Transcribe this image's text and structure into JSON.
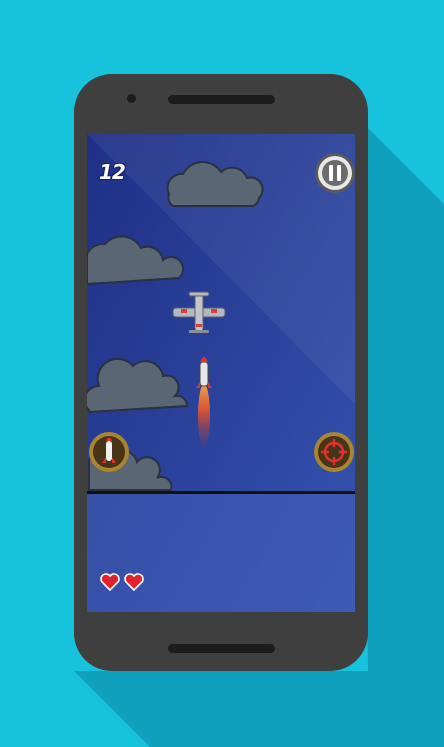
{
  "background_color": "#17c2dc",
  "phone": {
    "body_color": "#3f3f3f"
  },
  "game": {
    "score": "12",
    "lives": 2,
    "sky_color": "#2f48a0",
    "heart_color": "#e0232b",
    "icons": {
      "pause": "pause-icon",
      "missile": "missile-icon",
      "target": "crosshair-icon",
      "heart": "heart-icon",
      "plane": "plane-icon",
      "cloud": "cloud-icon"
    }
  }
}
